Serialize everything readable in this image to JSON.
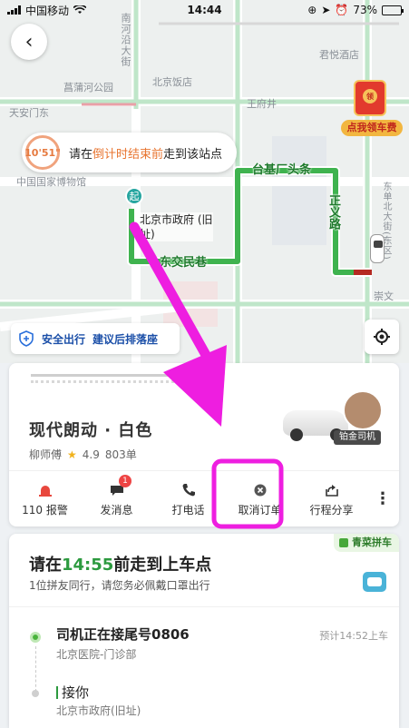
{
  "status_bar": {
    "carrier": "中国移动",
    "time": "14:44",
    "battery": "73%",
    "battery_level": 0.73
  },
  "map": {
    "labels": {
      "nanhe": "南河沿大街",
      "jinmao": "菖蒲河公园",
      "beijing_hotel": "北京饭店",
      "junyue": "君悦酒店",
      "tiananmen": "天安门东",
      "wangfujing": "王府井",
      "museum": "中国国家博物馆",
      "dongdan": "东单",
      "chongwen": "崇文"
    },
    "roads": {
      "taiji": "台基厂头条",
      "dongjiaominxiang": "东交民巷",
      "zhengyi": "正义路",
      "taiji_vertical": "台基厂大街",
      "dongsheng": "东单北大街(东区)"
    },
    "hint": {
      "timer": "10'51\"",
      "prefix": "请在",
      "highlight": "倒计时结束前",
      "suffix": "走到该站点"
    },
    "start_pin": "起",
    "start_label_line1": "北京市政府 (旧",
    "start_label_line2": "址)",
    "redpacket": {
      "coin": "领",
      "label": "点我领车费"
    },
    "safety": {
      "title": "安全出行",
      "subtitle": "建议后排落座"
    }
  },
  "driver": {
    "car_model": "现代朗动 · 白色",
    "name": "柳师傅",
    "rating": "4.9",
    "orders": "803单",
    "badge": "铂金司机"
  },
  "actions": [
    {
      "label": "110 报警",
      "icon": "alarm-icon"
    },
    {
      "label": "发消息",
      "icon": "message-icon",
      "badge": "1"
    },
    {
      "label": "打电话",
      "icon": "phone-icon"
    },
    {
      "label": "取消订单",
      "icon": "cancel-icon"
    },
    {
      "label": "行程分享",
      "icon": "share-icon"
    },
    {
      "label": "⋮",
      "icon": "more-icon"
    }
  ],
  "trip": {
    "pool_tag": "青菜拼车",
    "title_prefix": "请在",
    "title_time": "14:55",
    "title_suffix": "前走到上车点",
    "subtitle": "1位拼友同行，请您务必佩戴口罩出行",
    "step1_title": "司机正在接尾号0806",
    "step1_sub": "北京医院-门诊部",
    "step1_eta": "预计14:52上车",
    "step2_title": "接你",
    "step2_sub": "北京市政府(旧址)"
  },
  "colors": {
    "route": "#3fb34f",
    "accent_orange": "#e8742f",
    "annotation": "#ee1ee0",
    "pickup_green": "#2c9a3f"
  }
}
